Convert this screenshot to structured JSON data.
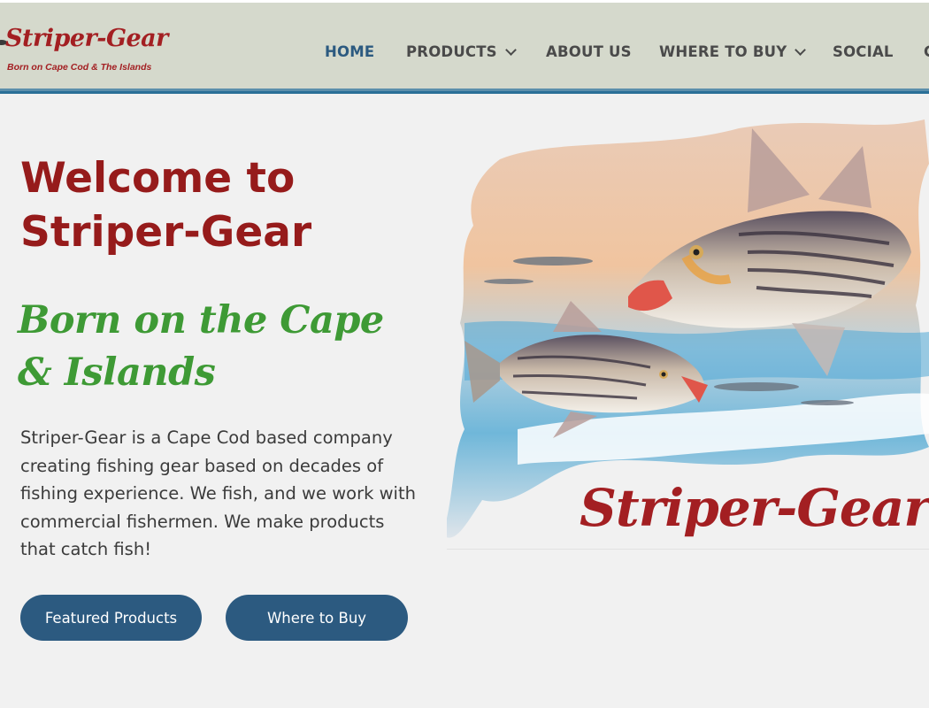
{
  "header": {
    "logo": {
      "title": "Striper-Gear",
      "subtitle": "Born on Cape Cod & The Islands"
    },
    "nav": [
      {
        "label": "HOME",
        "active": true
      },
      {
        "label": "PRODUCTS",
        "dropdown": true
      },
      {
        "label": "ABOUT US"
      },
      {
        "label": "WHERE TO BUY",
        "dropdown": true
      },
      {
        "label": "SOCIAL"
      },
      {
        "label": "C"
      }
    ]
  },
  "hero": {
    "headline": "Welcome to Striper-Gear",
    "tagline": "Born on the Cape & Islands",
    "description": "Striper-Gear is a Cape Cod based company creating fishing gear based on decades of fishing experience. We fish, and we work with commercial fishermen. We make products that catch fish!",
    "buttons": {
      "featured": "Featured Products",
      "where": "Where to Buy"
    },
    "image_brand": "Striper-Gear"
  },
  "colors": {
    "header_bg": "#d5d9cc",
    "accent_blue": "#2c5a80",
    "brand_red": "#961b1b",
    "tagline_green": "#3e9a35"
  }
}
